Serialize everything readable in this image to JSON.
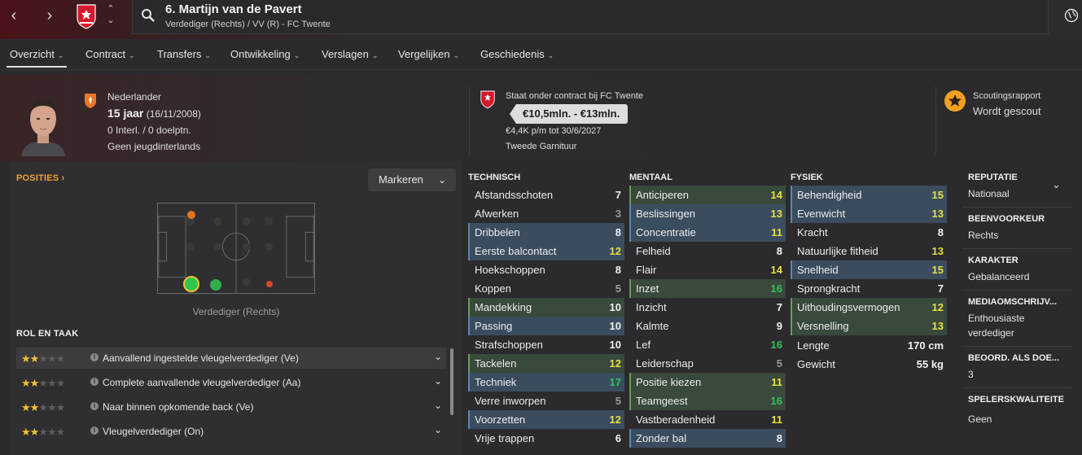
{
  "header": {
    "back_icon": "chevron-left-icon",
    "forward_icon": "chevron-right-icon",
    "player_title": "6. Martijn van de Pavert",
    "player_subtitle": "Verdediger (Rechts) / VV (R) - FC Twente"
  },
  "tabs": [
    {
      "label": "Overzicht"
    },
    {
      "label": "Contract"
    },
    {
      "label": "Transfers"
    },
    {
      "label": "Ontwikkeling"
    },
    {
      "label": "Verslagen"
    },
    {
      "label": "Vergelijken"
    },
    {
      "label": "Geschiedenis"
    }
  ],
  "profile": {
    "nationality": "Nederlander",
    "age": "15 jaar",
    "dob": "(16/11/2008)",
    "caps": "0 Interl. / 0 doelptn.",
    "youth_caps": "Geen jeugdinterlands",
    "contract_status": "Staat onder contract bij FC Twente",
    "value_range": "€10,5mln. - €13mln.",
    "wage": "€4,4K p/m tot 30/6/2027",
    "squad_status": "Tweede Garnituur",
    "scouting_title": "Scoutingsrapport",
    "scouting_status": "Wordt gescout"
  },
  "positions": {
    "title": "POSITIES",
    "title_arrow": "›",
    "mark_button": "Markeren",
    "position_label": "Verdediger (Rechts)"
  },
  "roles": {
    "title": "ROL EN TAAK",
    "items": [
      {
        "label": "Aanvallend ingestelde vleugelverdediger (Ve)",
        "stars": 2
      },
      {
        "label": "Complete aanvallende vleugelverdediger (Aa)",
        "stars": 2
      },
      {
        "label": "Naar binnen opkomende back (Ve)",
        "stars": 2
      },
      {
        "label": "Vleugelverdediger (On)",
        "stars": 2
      }
    ]
  },
  "technical": {
    "title": "TECHNISCH",
    "items": [
      {
        "name": "Afstandsschoten",
        "value": "7"
      },
      {
        "name": "Afwerken",
        "value": "3"
      },
      {
        "name": "Dribbelen",
        "value": "8"
      },
      {
        "name": "Eerste balcontact",
        "value": "12"
      },
      {
        "name": "Hoekschoppen",
        "value": "8"
      },
      {
        "name": "Koppen",
        "value": "5"
      },
      {
        "name": "Mandekking",
        "value": "10"
      },
      {
        "name": "Passing",
        "value": "10"
      },
      {
        "name": "Strafschoppen",
        "value": "10"
      },
      {
        "name": "Tackelen",
        "value": "12"
      },
      {
        "name": "Techniek",
        "value": "17"
      },
      {
        "name": "Verre inworpen",
        "value": "5"
      },
      {
        "name": "Voorzetten",
        "value": "12"
      },
      {
        "name": "Vrije trappen",
        "value": "6"
      }
    ]
  },
  "mental": {
    "title": "MENTAAL",
    "items": [
      {
        "name": "Anticiperen",
        "value": "14"
      },
      {
        "name": "Beslissingen",
        "value": "13"
      },
      {
        "name": "Concentratie",
        "value": "11"
      },
      {
        "name": "Felheid",
        "value": "8"
      },
      {
        "name": "Flair",
        "value": "14"
      },
      {
        "name": "Inzet",
        "value": "16"
      },
      {
        "name": "Inzicht",
        "value": "7"
      },
      {
        "name": "Kalmte",
        "value": "9"
      },
      {
        "name": "Lef",
        "value": "16"
      },
      {
        "name": "Leiderschap",
        "value": "5"
      },
      {
        "name": "Positie kiezen",
        "value": "11"
      },
      {
        "name": "Teamgeest",
        "value": "16"
      },
      {
        "name": "Vastberadenheid",
        "value": "11"
      },
      {
        "name": "Zonder bal",
        "value": "8"
      }
    ]
  },
  "physical": {
    "title": "FYSIEK",
    "items": [
      {
        "name": "Behendigheid",
        "value": "15"
      },
      {
        "name": "Evenwicht",
        "value": "13"
      },
      {
        "name": "Kracht",
        "value": "8"
      },
      {
        "name": "Natuurlijke fitheid",
        "value": "13"
      },
      {
        "name": "Snelheid",
        "value": "15"
      },
      {
        "name": "Sprongkracht",
        "value": "7"
      },
      {
        "name": "Uithoudingsvermogen",
        "value": "12"
      },
      {
        "name": "Versnelling",
        "value": "13"
      }
    ],
    "height_label": "Lengte",
    "height_value": "170 cm",
    "weight_label": "Gewicht",
    "weight_value": "55 kg"
  },
  "side": {
    "reputation_title": "REPUTATIE",
    "reputation_value": "Nationaal",
    "foot_title": "BEENVOORKEUR",
    "foot_value": "Rechts",
    "character_title": "KARAKTER",
    "character_value": "Gebalanceerd",
    "media_title": "MEDIAOMSCHRIJV...",
    "media_value_1": "Enthousiaste",
    "media_value_2": "verdediger",
    "rating_title": "BEOORD. ALS DOE...",
    "rating_value": "3",
    "qualities_title": "SPELERSKWALITEITE",
    "qualities_value": "Geen"
  }
}
